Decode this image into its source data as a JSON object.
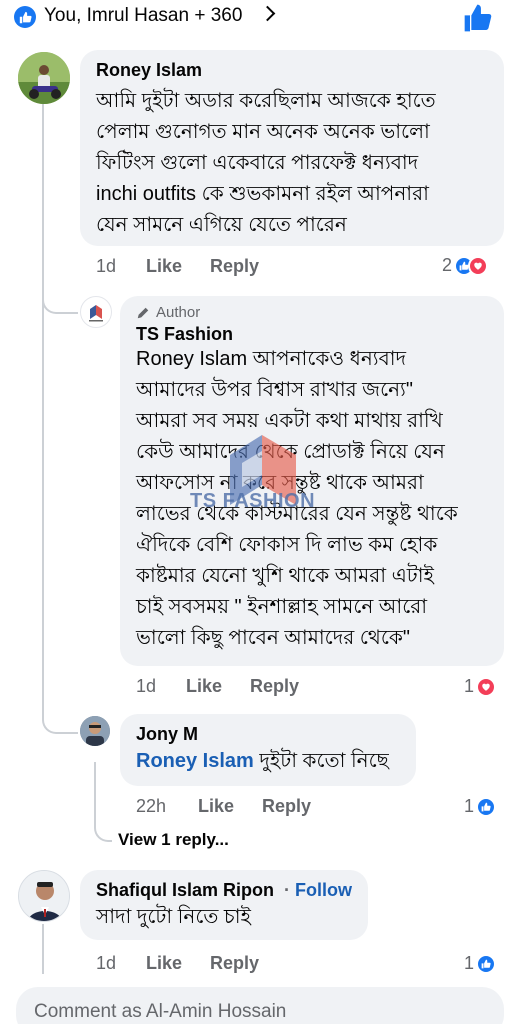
{
  "header": {
    "reactors": "You, Imrul Hasan + 360"
  },
  "comments": [
    {
      "name": "Roney Islam",
      "text": "আমি দুইটা অডার করেছিলাম আজকে হাতে\nপেলাম গুনোগত মান অনেক অনেক ভালো\nফিটিংস গুলো একেবারে পারফেক্ট  ধন্যবাদ\ninchi outfits কে শুভকামনা রইল আপনারা\nযেন সামনে এগিয়ে যেতে পারেন",
      "time": "1d",
      "like": "Like",
      "reply": "Reply",
      "reactions": "2"
    },
    {
      "badge": "Author",
      "name": "TS Fashion",
      "text": "Roney Islam আপনাকেও ধন্যবাদ\nআমাদের উপর বিশ্বাস রাখার জন্যে\"\nআমরা সব সময় একটা কথা মাথায় রাখি\nকেউ আমাদের থেকে প্রোডাক্ট নিয়ে যেন\nআফসোস না করে সন্তুষ্ট থাকে আমরা\nলাভের  থেকে কাস্টমারের যেন সন্তুষ্ট থাকে\nঐদিকে বেশি ফোকাস দি লাভ কম হোক\nকাষ্টমার যেনো খুশি থাকে আমরা এটাই\nচাই সবসময় \" ইনশাল্লাহ সামনে আরো\nভালো কিছু পাবেন আমাদের থেকে\"",
      "time": "1d",
      "like": "Like",
      "reply": "Reply",
      "reactions": "1"
    },
    {
      "name": "Jony M",
      "mention": "Roney Islam",
      "text": " দুইটা কতো নিছে",
      "time": "22h",
      "like": "Like",
      "reply": "Reply",
      "reactions": "1"
    },
    {
      "view_replies": "View 1 reply..."
    },
    {
      "name": "Shafiqul Islam Ripon",
      "follow": "Follow",
      "text": "সাদা দুটো নিতে চাই",
      "time": "1d",
      "like": "Like",
      "reply": "Reply",
      "reactions": "1"
    }
  ],
  "watermark": {
    "text": "TS FASHION"
  },
  "composer": {
    "placeholder": "Comment as Al-Amin Hossain"
  },
  "colors": {
    "facebook_blue": "#1877f2",
    "love_red": "#f33e58",
    "bubble": "#f0f2f5",
    "secondary_text": "#65676b"
  }
}
